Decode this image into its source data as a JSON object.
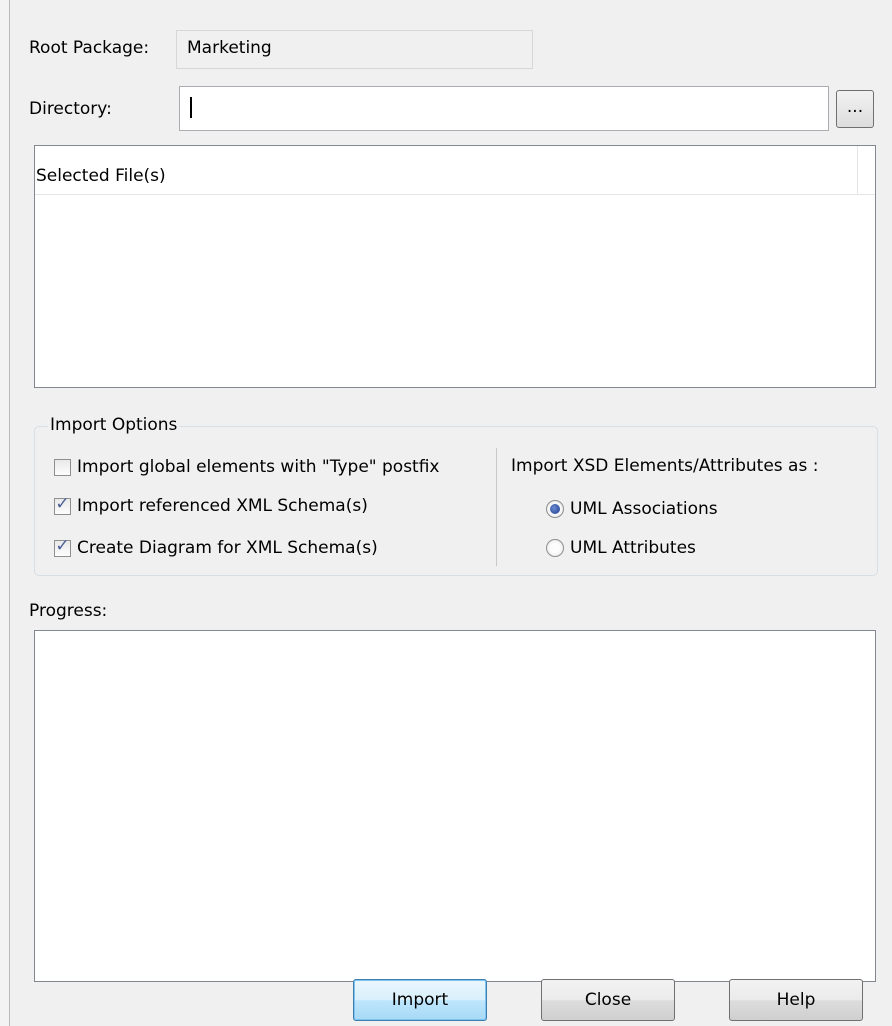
{
  "root_package": {
    "label": "Root Package:",
    "value": "Marketing"
  },
  "directory": {
    "label": "Directory:",
    "value": "",
    "browse_label": "..."
  },
  "file_list": {
    "column_header": "Selected File(s)",
    "rows": []
  },
  "import_options": {
    "title": "Import Options",
    "checkboxes": [
      {
        "label": "Import global elements with \"Type\" postfix",
        "checked": false
      },
      {
        "label": "Import referenced XML Schema(s)",
        "checked": true
      },
      {
        "label": "Create Diagram for XML Schema(s)",
        "checked": true
      }
    ],
    "radio_group_label": "Import XSD Elements/Attributes as :",
    "radios": [
      {
        "label": "UML Associations",
        "selected": true
      },
      {
        "label": "UML Attributes",
        "selected": false
      }
    ]
  },
  "progress": {
    "label": "Progress:",
    "text": ""
  },
  "buttons": {
    "import": "Import",
    "close": "Close",
    "help": "Help"
  },
  "glyphs": {
    "check": "✓"
  }
}
